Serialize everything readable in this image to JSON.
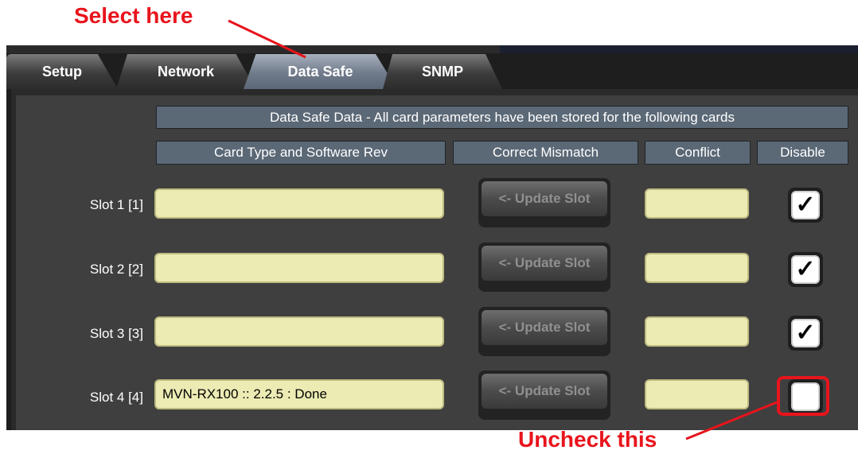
{
  "annotations": {
    "select_here": "Select  here",
    "uncheck_this": "Uncheck this",
    "color": "#e8141c"
  },
  "tabs": [
    {
      "label": "Setup",
      "active": false
    },
    {
      "label": "Network",
      "active": false
    },
    {
      "label": "Data Safe",
      "active": true
    },
    {
      "label": "SNMP",
      "active": false
    }
  ],
  "table": {
    "banner": "Data Safe Data - All card parameters have been stored for the following cards",
    "columns": [
      "Card Type and Software Rev",
      "Correct Mismatch",
      "Conflict",
      "Disable"
    ],
    "update_button_label": "<- Update Slot",
    "rows": [
      {
        "slot": "Slot 1 [1]",
        "card": "",
        "conflict": "",
        "disable": true
      },
      {
        "slot": "Slot 2 [2]",
        "card": "",
        "conflict": "",
        "disable": true
      },
      {
        "slot": "Slot 3 [3]",
        "card": "",
        "conflict": "",
        "disable": true
      },
      {
        "slot": "Slot 4 [4]",
        "card": "MVN-RX100  :: 2.2.5 : Done",
        "conflict": "",
        "disable": false
      }
    ]
  },
  "icons": {
    "check": "checkmark-icon"
  }
}
